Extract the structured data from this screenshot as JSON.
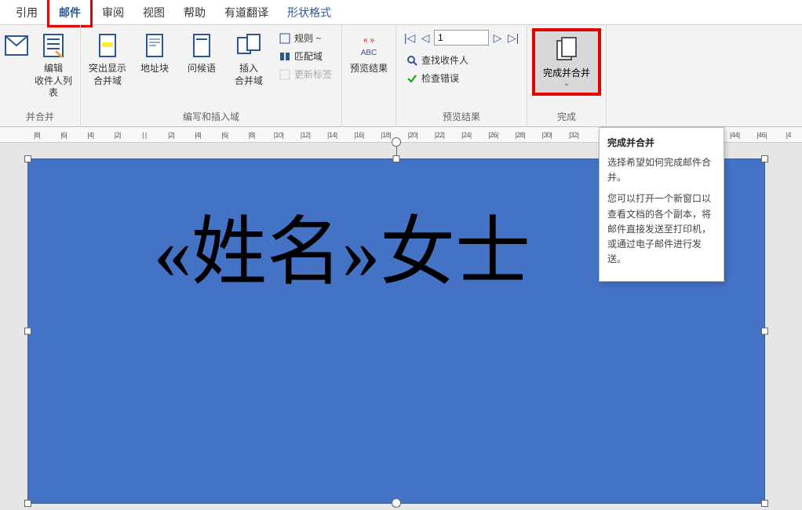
{
  "tabs": {
    "yinyong": "引用",
    "youjian": "邮件",
    "shenyue": "审阅",
    "shitu": "视图",
    "bangzhu": "帮助",
    "youdao": "有道翻译",
    "xingzhuang": "形状格式"
  },
  "ribbon": {
    "group1": {
      "btn1": "",
      "btn2_line1": "编辑",
      "btn2_line2": "收件人列表",
      "label": "并合并"
    },
    "group2": {
      "btn1_line1": "突出显示",
      "btn1_line2": "合并域",
      "btn2": "地址块",
      "btn3": "问候语",
      "btn4_line1": "插入",
      "btn4_line2": "合并域",
      "small1": "规则 ~",
      "small2": "匹配域",
      "small3": "更新标签",
      "label": "编写和插入域"
    },
    "group3": {
      "btn1": "预览结果",
      "label": ""
    },
    "group4": {
      "nav_value": "1",
      "small1": "查找收件人",
      "small2": "检查错误",
      "label": "预览结果"
    },
    "group5": {
      "btn1": "完成并合并",
      "label": "完成"
    }
  },
  "tooltip": {
    "title": "完成并合并",
    "p1": "选择希望如何完成邮件合并。",
    "p2": "您可以打开一个新窗口以查看文档的各个副本，将邮件直接发送至打印机，或通过电子邮件进行发送。"
  },
  "ruler": [
    "|8|",
    "|6|",
    "|4|",
    "|2|",
    "| |",
    "|2|",
    "|4|",
    "|6|",
    "|8|",
    "|10|",
    "|12|",
    "|14|",
    "|16|",
    "|18|",
    "|20|",
    "|22|",
    "|24|",
    "|26|",
    "|28|",
    "|30|",
    "|32|",
    "",
    "",
    "",
    "",
    "",
    "|44|",
    "|46|",
    "|4"
  ],
  "document": {
    "text": "«姓名»女士"
  }
}
